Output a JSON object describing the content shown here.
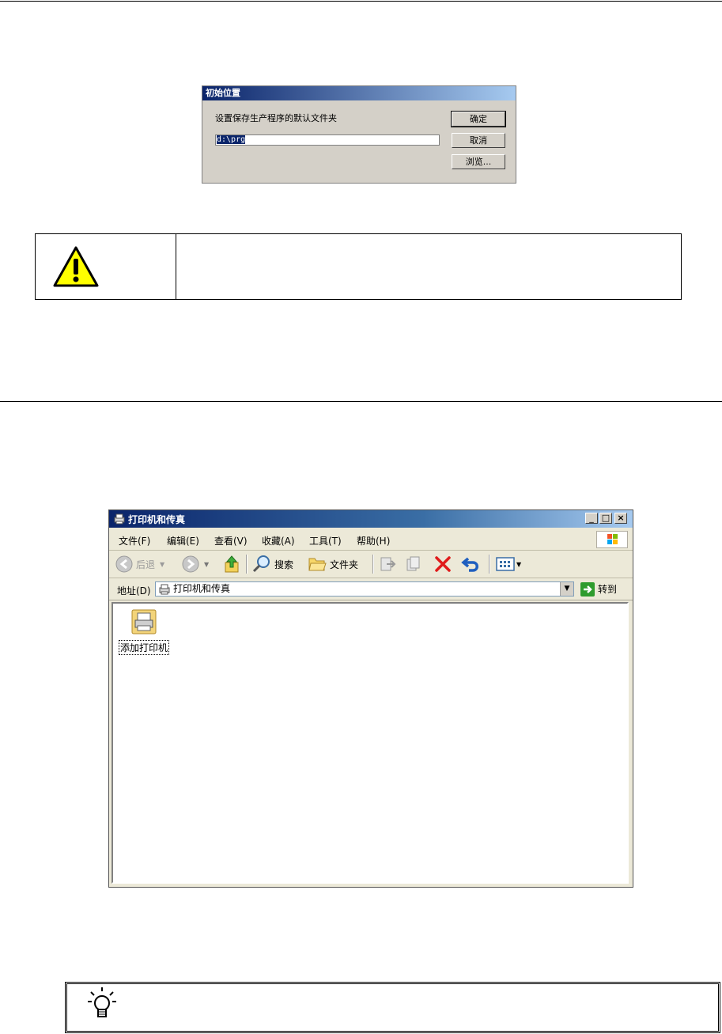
{
  "dialog": {
    "title": "初始位置",
    "label": "设置保存生产程序的默认文件夹",
    "path_value": "d:\\prg",
    "ok_label": "确定",
    "cancel_label": "取消",
    "browse_label": "浏览..."
  },
  "warning": {
    "icon": "warning-icon",
    "text": ""
  },
  "explorer": {
    "title": "打印机和传真",
    "menu": [
      "文件(F)",
      "编辑(E)",
      "查看(V)",
      "收藏(A)",
      "工具(T)",
      "帮助(H)"
    ],
    "toolbar": {
      "back_label": "后退",
      "search_label": "搜索",
      "folders_label": "文件夹"
    },
    "address": {
      "label": "地址(D)",
      "value": "打印机和传真",
      "go_label": "转到"
    },
    "items": [
      {
        "label": "添加打印机",
        "icon": "printer-icon"
      }
    ]
  },
  "tip": {
    "icon": "lightbulb-icon",
    "text": ""
  },
  "colors": {
    "dialog_bg": "#d4d0c8",
    "title_blue": "#0a246a",
    "warning_yellow": "#ffff00",
    "window_bg": "#ece9d8"
  }
}
